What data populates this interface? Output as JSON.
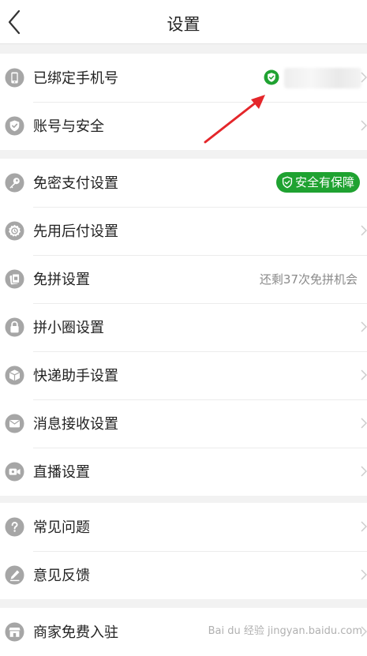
{
  "header": {
    "title": "设置",
    "back_icon": "chevron-left-icon"
  },
  "account_section": {
    "bound_phone": {
      "label": "已绑定手机号",
      "icon": "phone-icon",
      "status_icon": "verified-check-icon",
      "status_color": "#1fa231"
    },
    "account_security": {
      "label": "账号与安全",
      "icon": "shield-icon"
    }
  },
  "payment_section": {
    "items": [
      {
        "label": "免密支付设置",
        "icon": "key-icon",
        "badge": "安全有保障",
        "badge_color": "#1fa231"
      },
      {
        "label": "先用后付设置",
        "icon": "pay-later-icon"
      },
      {
        "label": "免拼设置",
        "icon": "free-group-icon",
        "value": "还剩37次免拼机会"
      },
      {
        "label": "拼小圈设置",
        "icon": "lock-icon"
      },
      {
        "label": "快递助手设置",
        "icon": "package-icon"
      },
      {
        "label": "消息接收设置",
        "icon": "mail-icon"
      },
      {
        "label": "直播设置",
        "icon": "video-camera-icon"
      }
    ]
  },
  "help_section": {
    "items": [
      {
        "label": "常见问题",
        "icon": "question-icon"
      },
      {
        "label": "意见反馈",
        "icon": "pencil-icon"
      }
    ]
  },
  "merchant_section": {
    "items": [
      {
        "label": "商家免费入驻",
        "icon": "store-icon"
      }
    ]
  },
  "watermark": "Bai du 经验 jingyan.baidu.com",
  "colors": {
    "accent_green": "#1fa231",
    "arrow_red": "#e4262a",
    "icon_gray": "#a6a6a6"
  }
}
